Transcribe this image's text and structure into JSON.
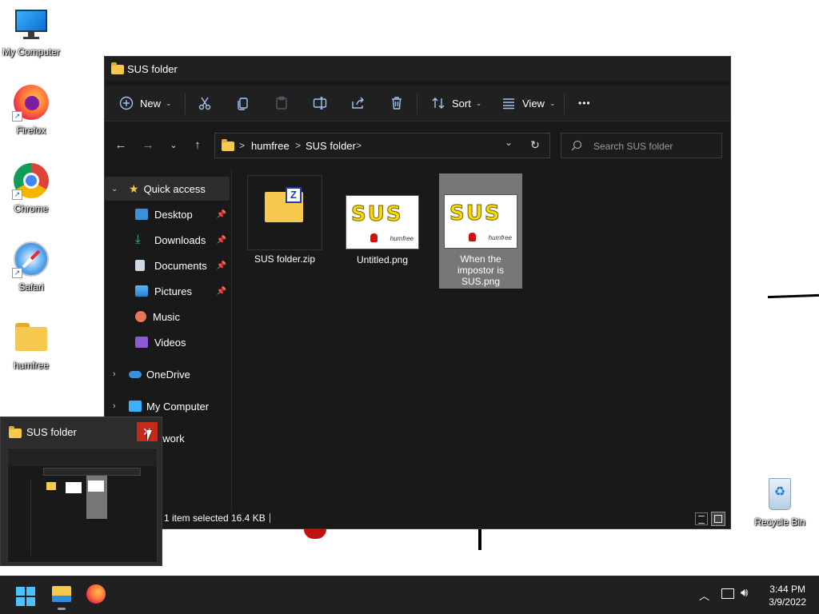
{
  "desktop": {
    "icons": [
      {
        "label": "My Computer",
        "icon": "monitor-icon"
      },
      {
        "label": "Firefox",
        "icon": "firefox-icon"
      },
      {
        "label": "Chrome",
        "icon": "chrome-icon"
      },
      {
        "label": "Safari",
        "icon": "safari-icon"
      },
      {
        "label": "humfree",
        "icon": "folder-icon"
      },
      {
        "label": "Recycle Bin",
        "icon": "recycle-bin-icon"
      }
    ]
  },
  "window": {
    "title": "SUS folder",
    "toolbar": {
      "new_label": "New",
      "sort_label": "Sort",
      "view_label": "View",
      "more_label": "•••"
    },
    "address": {
      "segments": [
        "humfree",
        "SUS folder"
      ],
      "sep": ">"
    },
    "search": {
      "placeholder": "Search SUS folder"
    },
    "nav": {
      "quick_access": "Quick access",
      "items": [
        {
          "label": "Desktop",
          "pinned": true
        },
        {
          "label": "Downloads",
          "pinned": true
        },
        {
          "label": "Documents",
          "pinned": true
        },
        {
          "label": "Pictures",
          "pinned": true
        },
        {
          "label": "Music",
          "pinned": false
        },
        {
          "label": "Videos",
          "pinned": false
        }
      ],
      "onedrive": "OneDrive",
      "my_computer": "My Computer",
      "network": "Network"
    },
    "files": [
      {
        "name": "SUS folder.zip",
        "type": "zip"
      },
      {
        "name": "Untitled.png",
        "type": "image"
      },
      {
        "name": "When the impostor is SUS.png",
        "type": "image",
        "selected": true
      }
    ],
    "thumb_text": {
      "sus": "SUS",
      "hum": "humfree"
    },
    "status": {
      "selection": "1 item selected",
      "size": "16.4 KB"
    }
  },
  "preview": {
    "title": "SUS folder",
    "close": "✕"
  },
  "taskbar": {
    "time": "3:44 PM",
    "date": "3/9/2022"
  },
  "colors": {
    "accent": "#9fc4f0",
    "folder": "#f6c84d",
    "close_red": "#c42b1c",
    "selection": "#777777"
  }
}
